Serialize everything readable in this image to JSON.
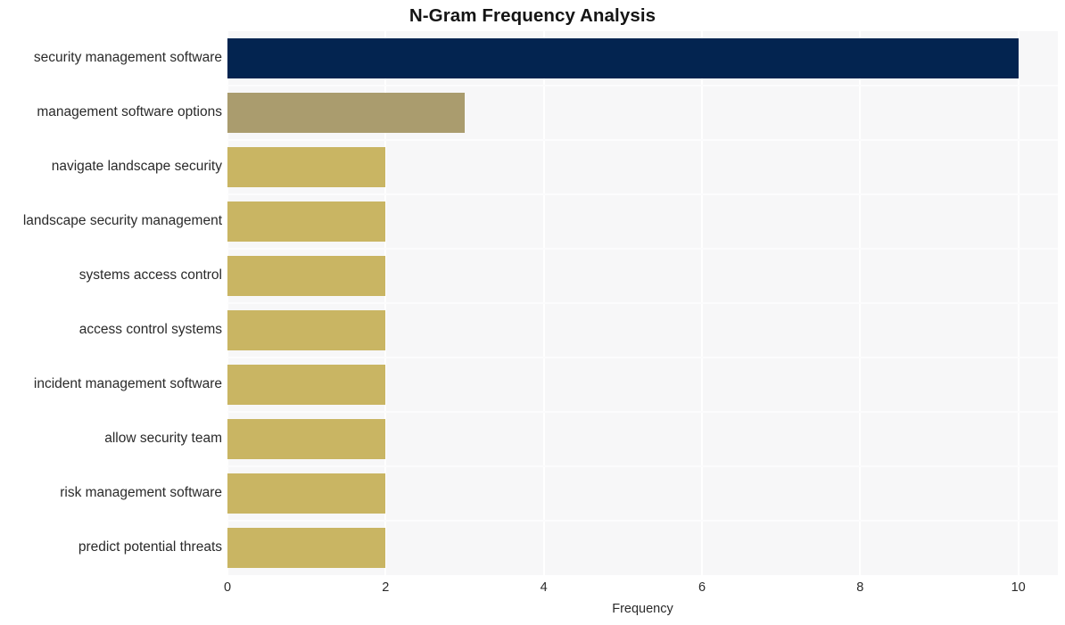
{
  "chart_data": {
    "type": "bar",
    "orientation": "horizontal",
    "title": "N-Gram Frequency Analysis",
    "xlabel": "Frequency",
    "ylabel": "",
    "xlim": [
      0,
      10.5
    ],
    "xticks": [
      "0",
      "2",
      "4",
      "6",
      "8",
      "10"
    ],
    "xtick_values": [
      0,
      2,
      4,
      6,
      8,
      10
    ],
    "grid": true,
    "legend": null,
    "categories": [
      "security management software",
      "management software options",
      "navigate landscape security",
      "landscape security management",
      "systems access control",
      "access control systems",
      "incident management software",
      "allow security team",
      "risk management software",
      "predict potential threats"
    ],
    "values": [
      10,
      3,
      2,
      2,
      2,
      2,
      2,
      2,
      2,
      2
    ],
    "bar_colors": [
      "#032450",
      "#aa9c6e",
      "#c9b563",
      "#c9b563",
      "#c9b563",
      "#c9b563",
      "#c9b563",
      "#c9b563",
      "#c9b563",
      "#c9b563"
    ]
  },
  "style": {
    "plot_background": "#f7f7f8",
    "figure_background": "#ffffff",
    "gridline_color": "#ffffff",
    "text_color": "#2a2a2a",
    "title_color": "#141414"
  }
}
